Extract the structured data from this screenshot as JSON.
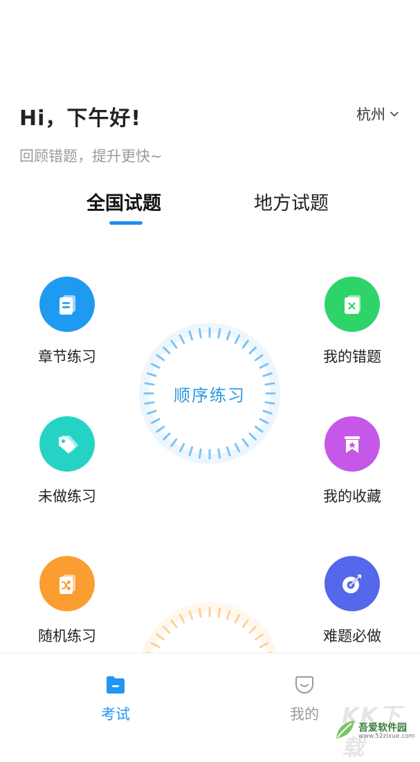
{
  "header": {
    "greeting": "Hi，下午好!",
    "subtitle": "回顾错题，提升更快~",
    "city": "杭州"
  },
  "tabs": [
    {
      "label": "全国试题",
      "active": true
    },
    {
      "label": "地方试题",
      "active": false
    }
  ],
  "left_items": [
    {
      "label": "章节练习",
      "icon": "document-icon",
      "color": "#1e9bf0"
    },
    {
      "label": "未做练习",
      "icon": "tag-icon",
      "color": "#25d3c4"
    },
    {
      "label": "随机练习",
      "icon": "shuffle-icon",
      "color": "#fb9d30"
    }
  ],
  "right_items": [
    {
      "label": "我的错题",
      "icon": "wrong-book-icon",
      "color": "#2fd468"
    },
    {
      "label": "我的收藏",
      "icon": "star-bookmark-icon",
      "color": "#c558e8"
    },
    {
      "label": "难题必做",
      "icon": "target-icon",
      "color": "#5567ea"
    }
  ],
  "center": {
    "label": "顺序练习",
    "ring_color": "#7cc4f5",
    "second_ring_color": "#fbd29a"
  },
  "bottom_nav": [
    {
      "label": "考试",
      "icon": "folder-icon",
      "active": true
    },
    {
      "label": "我的",
      "icon": "smile-icon",
      "active": false
    }
  ],
  "watermark": {
    "big": "KK下载",
    "name": "吾爱软件园",
    "url": "www.52zixue.com"
  }
}
